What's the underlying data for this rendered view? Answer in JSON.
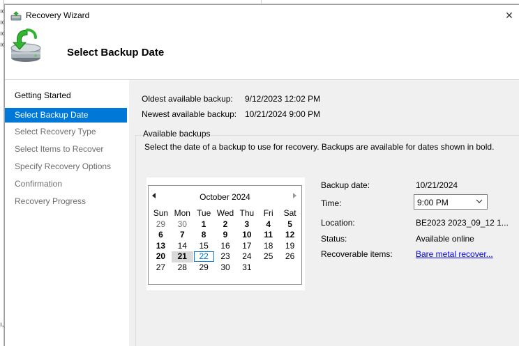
{
  "window": {
    "title": "Recovery Wizard",
    "close_glyph": "✕",
    "app_icon": "recovery-wizard-icon"
  },
  "header": {
    "page_title": "Select Backup Date",
    "icon": "backup-restore-icon"
  },
  "sidebar": {
    "items": [
      {
        "label": "Getting Started",
        "state": "completed"
      },
      {
        "label": "Select Backup Date",
        "state": "active"
      },
      {
        "label": "Select Recovery Type",
        "state": "pending"
      },
      {
        "label": "Select Items to Recover",
        "state": "pending"
      },
      {
        "label": "Specify Recovery Options",
        "state": "pending"
      },
      {
        "label": "Confirmation",
        "state": "pending"
      },
      {
        "label": "Recovery Progress",
        "state": "pending"
      }
    ]
  },
  "summary": {
    "oldest_label": "Oldest available backup:",
    "oldest_value": "9/12/2023 12:02 PM",
    "newest_label": "Newest available backup:",
    "newest_value": "10/21/2024 9:00 PM"
  },
  "available_backups": {
    "group_title": "Available backups",
    "description": "Select the date of a backup to use for recovery. Backups are available for dates shown in bold."
  },
  "calendar": {
    "month_label": "October 2024",
    "weekdays": [
      "Sun",
      "Mon",
      "Tue",
      "Wed",
      "Thu",
      "Fri",
      "Sat"
    ],
    "weeks": [
      [
        {
          "d": "29",
          "dim": true
        },
        {
          "d": "30",
          "dim": true
        },
        {
          "d": "1",
          "bold": true
        },
        {
          "d": "2",
          "bold": true
        },
        {
          "d": "3",
          "bold": true
        },
        {
          "d": "4",
          "bold": true
        },
        {
          "d": "5",
          "bold": true
        }
      ],
      [
        {
          "d": "6",
          "bold": true
        },
        {
          "d": "7",
          "bold": true
        },
        {
          "d": "8",
          "bold": true
        },
        {
          "d": "9",
          "bold": true
        },
        {
          "d": "10",
          "bold": true
        },
        {
          "d": "11",
          "bold": true
        },
        {
          "d": "12",
          "bold": true
        }
      ],
      [
        {
          "d": "13",
          "bold": true
        },
        {
          "d": "14"
        },
        {
          "d": "15"
        },
        {
          "d": "16"
        },
        {
          "d": "17"
        },
        {
          "d": "18"
        },
        {
          "d": "19"
        }
      ],
      [
        {
          "d": "20",
          "bold": true
        },
        {
          "d": "21",
          "bold": true,
          "selected": true
        },
        {
          "d": "22",
          "today": true
        },
        {
          "d": "23"
        },
        {
          "d": "24"
        },
        {
          "d": "25"
        },
        {
          "d": "26"
        }
      ],
      [
        {
          "d": "27"
        },
        {
          "d": "28"
        },
        {
          "d": "29"
        },
        {
          "d": "30"
        },
        {
          "d": "31"
        },
        {
          "d": ""
        },
        {
          "d": ""
        }
      ]
    ]
  },
  "details": {
    "backup_date_label": "Backup date:",
    "backup_date_value": "10/21/2024",
    "time_label": "Time:",
    "time_value": "9:00 PM",
    "location_label": "Location:",
    "location_value": "BE2023 2023_09_12 1...",
    "status_label": "Status:",
    "status_value": "Available online",
    "recoverable_label": "Recoverable items:",
    "recoverable_value": "Bare metal recover..."
  },
  "background": {
    "fragments": [
      "ıc",
      "ıc",
      "ıc",
      "ıc",
      "ı,"
    ]
  },
  "colors": {
    "accent": "#0078d7",
    "panel": "#f0f0f0",
    "link": "#0000ee",
    "disabled_text": "#6d6d6d"
  }
}
